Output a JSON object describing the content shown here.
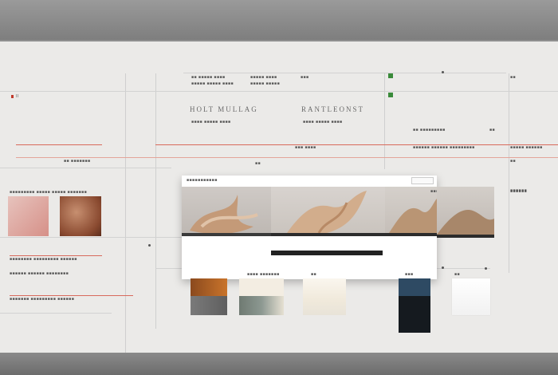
{
  "header": {
    "title_left": "HOLT MULLAG",
    "title_right": "RANTLEONST"
  },
  "annotations": {
    "left_top": "II",
    "col_a_1": "■■ ■■■■■ ■■■■",
    "col_a_2": "■■■■■ ■■■■■ ■■■■",
    "col_b_1": "■■■■■ ■■■■",
    "col_b_2": "■■■■■ ■■■■■",
    "sub_left": "■■■■ ■■■■■ ■■■■",
    "sub_right": "■■■■ ■■■■■ ■■■■",
    "right_small": "■■ ■■■■■■■■■",
    "red_mid": "■■■ ■■■■",
    "red_right": "■■■■■■ ■■■■■■ ■■■■■■■■■",
    "red_far": "■■■■■ ■■■■■■",
    "row_left": "■■ ■■■■■■■",
    "card_caption": "■■■■■■■■■ ■■■■■ ■■■■■ ■■■■■■■",
    "panel_left_caption": "■■■■■■■ ■■■■■■■■■ ■■■■■■",
    "panel_left_footer": "■■■■■■■■ ■■■■■■■■■ ■■■■■■",
    "panel_left_footer2": "■■■■■■ ■■■■■■ ■■■■■■■■",
    "swatch_caption": "■■■■ ■■■■■■■",
    "mid_label": "■■",
    "small_right": "■■■"
  },
  "device": {
    "toolbar_text": "■■■■■■■■■■■",
    "pane_labels": [
      "■■■■■■■■■■■■■■■■■",
      "■■■■■■■ ■■■■■■■■■",
      "■■■■■■"
    ]
  },
  "colors": {
    "accent_red": "#d86a5c",
    "accent_green": "#3a8a3a",
    "board": "#ebeae8"
  }
}
